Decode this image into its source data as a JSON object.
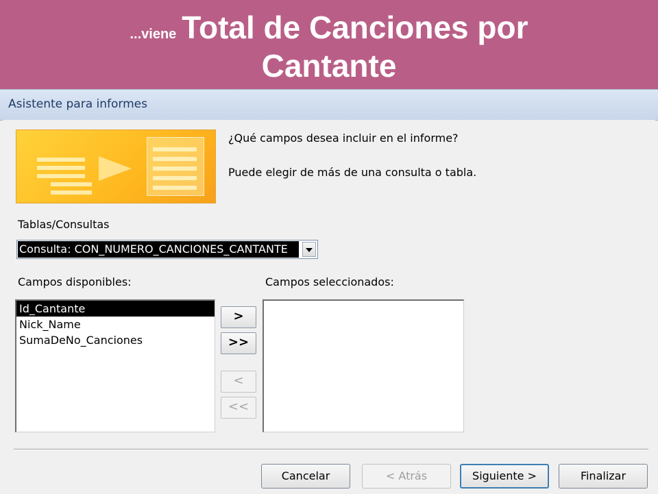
{
  "banner": {
    "prefix": "...viene",
    "title_line1": "Total de Canciones por",
    "title_line2": "Cantante",
    "background": "#b95f87"
  },
  "dialog": {
    "title": "Asistente para informes",
    "prompt_question": "¿Qué campos desea incluir en el informe?",
    "prompt_hint": "Puede elegir de más de una consulta o tabla.",
    "wizard_image_icon": "report-wizard-illustration"
  },
  "tables": {
    "label": "Tablas/Consultas",
    "selected": "Consulta: CON_NUMERO_CANCIONES_CANTANTE"
  },
  "available": {
    "label": "Campos disponibles:",
    "items": [
      "Id_Cantante",
      "Nick_Name",
      "SumaDeNo_Canciones"
    ],
    "selected_item": "Id_Cantante"
  },
  "chosen": {
    "label": "Campos seleccionados:",
    "items": []
  },
  "move_buttons": {
    "add_one": ">",
    "add_all": ">>",
    "remove_one": "<",
    "remove_all": "<<"
  },
  "footer": {
    "cancel": "Cancelar",
    "back": "< Atrás",
    "next": "Siguiente >",
    "finish": "Finalizar"
  }
}
